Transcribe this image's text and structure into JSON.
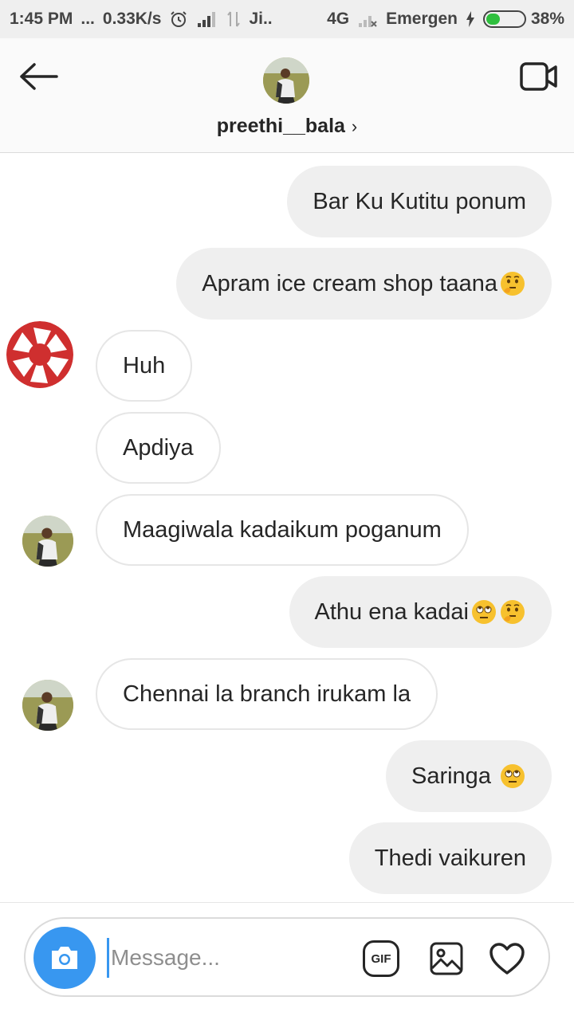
{
  "status_bar": {
    "time": "1:45 PM",
    "dots": "...",
    "speed": "0.33K/s",
    "carrier": "Ji..",
    "network": "4G",
    "emergency": "Emergen",
    "battery": "38%",
    "battery_level": 0.38,
    "icons": [
      "alarm-icon",
      "signal-icon",
      "data-arrows-icon",
      "no-signal-icon",
      "charging-icon"
    ]
  },
  "header": {
    "username": "preethi__bala",
    "chevron": "›",
    "icons": [
      "back-arrow-icon",
      "video-call-icon",
      "avatar"
    ]
  },
  "messages": [
    {
      "sender": "me",
      "text": "Bar Ku Kutitu ponum"
    },
    {
      "sender": "me",
      "text": "Apram ice cream shop taana",
      "emoji": [
        "thinking-face"
      ]
    },
    {
      "sender": "them",
      "text": "Huh"
    },
    {
      "sender": "them",
      "text": "Apdiya"
    },
    {
      "sender": "them",
      "text": "Maagiwala kadaikum poganum"
    },
    {
      "sender": "me",
      "text": "Athu ena kadai",
      "emoji": [
        "eye-roll-face",
        "thinking-face"
      ]
    },
    {
      "sender": "them",
      "text": "Chennai la branch irukam la"
    },
    {
      "sender": "me",
      "text": "Saringa ",
      "emoji": [
        "eye-roll-face"
      ]
    },
    {
      "sender": "me",
      "text": "Thedi vaikuren"
    }
  ],
  "composer": {
    "placeholder": "Message...",
    "gif_label": "GIF",
    "icons": [
      "camera-icon",
      "gif-icon",
      "gallery-icon",
      "heart-icon"
    ]
  },
  "colors": {
    "accent": "#3897f0",
    "outgoing_bubble": "#efefef",
    "incoming_border": "#e6e6e6",
    "shutter_red": "#d32f2f"
  }
}
